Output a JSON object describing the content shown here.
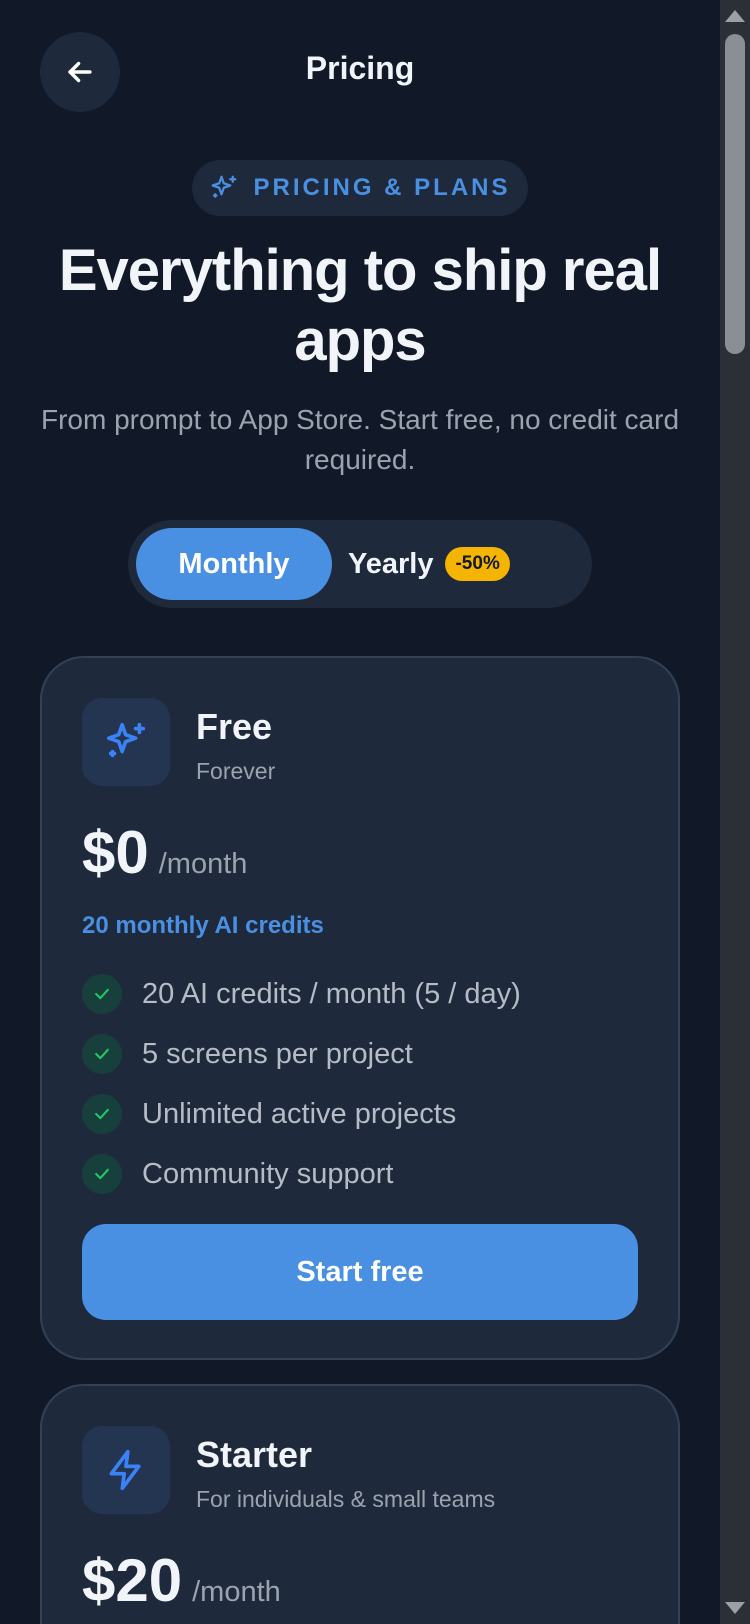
{
  "header": {
    "title": "Pricing",
    "back_icon": "arrow-left-icon"
  },
  "hero": {
    "eyebrow": "PRICING & PLANS",
    "eyebrow_icon": "sparkles-icon",
    "headline": "Everything to ship real apps",
    "subline": "From prompt to App Store. Start free, no credit card required."
  },
  "billing_toggle": {
    "monthly_label": "Monthly",
    "yearly_label": "Yearly",
    "yearly_badge": "-50%",
    "selected": "Monthly"
  },
  "plans": [
    {
      "name": "Free",
      "tagline": "Forever",
      "icon": "sparkles-icon",
      "price": "$0",
      "period": "/month",
      "credits": "20 monthly AI credits",
      "features": [
        "20 AI credits / month (5 / day)",
        "5 screens per project",
        "Unlimited active projects",
        "Community support"
      ],
      "cta": "Start free"
    },
    {
      "name": "Starter",
      "tagline": "For individuals & small teams",
      "icon": "lightning-icon",
      "price": "$20",
      "period": "/month"
    }
  ],
  "colors": {
    "background": "#111827",
    "card": "#1e293b",
    "accent": "#4a90e2",
    "badge": "#f5b400",
    "check": "#22c55e"
  }
}
